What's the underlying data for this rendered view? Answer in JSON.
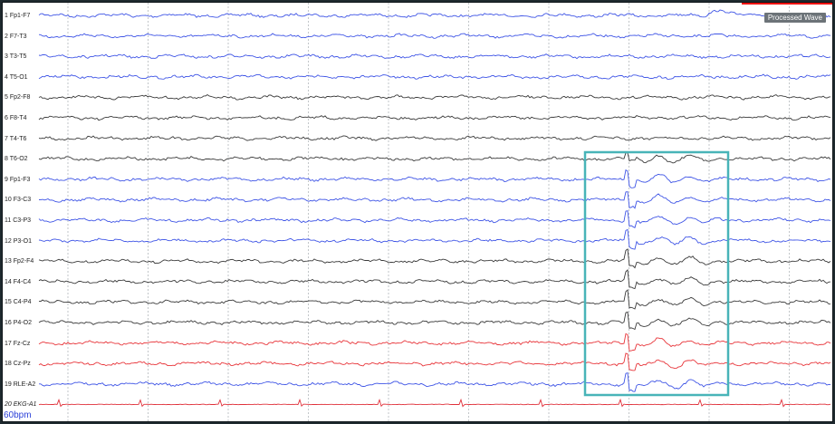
{
  "tag_label": "Processed Wave",
  "heart_rate": "60bpm",
  "colors": {
    "left": "#3f55e6",
    "right": "#3a3a3a",
    "midline": "#e8353a",
    "ekg": "#e0303a",
    "highlight": "#48b4b8"
  },
  "channels": [
    {
      "num": "1",
      "name": "Fp1-F7",
      "group": "left"
    },
    {
      "num": "2",
      "name": "F7-T3",
      "group": "left"
    },
    {
      "num": "3",
      "name": "T3-T5",
      "group": "left"
    },
    {
      "num": "4",
      "name": "T5-O1",
      "group": "left"
    },
    {
      "num": "5",
      "name": "Fp2-F8",
      "group": "right"
    },
    {
      "num": "6",
      "name": "F8-T4",
      "group": "right"
    },
    {
      "num": "7",
      "name": "T4-T6",
      "group": "right"
    },
    {
      "num": "8",
      "name": "T6-O2",
      "group": "right"
    },
    {
      "num": "9",
      "name": "Fp1-F3",
      "group": "left"
    },
    {
      "num": "10",
      "name": "F3-C3",
      "group": "left"
    },
    {
      "num": "11",
      "name": "C3-P3",
      "group": "left"
    },
    {
      "num": "12",
      "name": "P3-O1",
      "group": "left"
    },
    {
      "num": "13",
      "name": "Fp2-F4",
      "group": "right"
    },
    {
      "num": "14",
      "name": "F4-C4",
      "group": "right"
    },
    {
      "num": "15",
      "name": "C4-P4",
      "group": "right"
    },
    {
      "num": "16",
      "name": "P4-O2",
      "group": "right"
    },
    {
      "num": "17",
      "name": "Fz-Cz",
      "group": "midline"
    },
    {
      "num": "18",
      "name": "Cz-Pz",
      "group": "midline"
    },
    {
      "num": "19",
      "name": "RLE-A2",
      "group": "left"
    },
    {
      "num": "20",
      "name": "EKG-A1",
      "group": "ekg"
    }
  ]
}
